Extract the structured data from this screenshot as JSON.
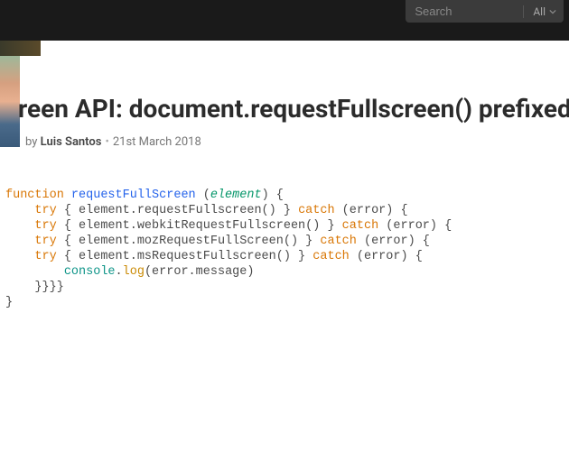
{
  "search": {
    "placeholder": "Search",
    "scope": "All"
  },
  "post": {
    "title": "reen API: document.requestFullscreen() prefixed",
    "by_label": "by ",
    "author": "Luis Santos",
    "date": "21st March 2018"
  },
  "code": {
    "tokens": [
      [
        [
          "kw",
          "function"
        ],
        [
          "pn",
          " "
        ],
        [
          "fn",
          "requestFullScreen"
        ],
        [
          "pn",
          " ("
        ],
        [
          "pr",
          "element"
        ],
        [
          "pn",
          ") {"
        ]
      ],
      [
        [
          "pn",
          "    "
        ],
        [
          "kw",
          "try"
        ],
        [
          "pn",
          " { element.requestFullscreen() } "
        ],
        [
          "kw",
          "catch"
        ],
        [
          "pn",
          " (error) {"
        ]
      ],
      [
        [
          "pn",
          "    "
        ],
        [
          "kw",
          "try"
        ],
        [
          "pn",
          " { element.webkitRequestFullscreen() } "
        ],
        [
          "kw",
          "catch"
        ],
        [
          "pn",
          " (error) {"
        ]
      ],
      [
        [
          "pn",
          "    "
        ],
        [
          "kw",
          "try"
        ],
        [
          "pn",
          " { element.mozRequestFullScreen() } "
        ],
        [
          "kw",
          "catch"
        ],
        [
          "pn",
          " (error) {"
        ]
      ],
      [
        [
          "pn",
          "    "
        ],
        [
          "kw",
          "try"
        ],
        [
          "pn",
          " { element.msRequestFullscreen() } "
        ],
        [
          "kw",
          "catch"
        ],
        [
          "pn",
          " (error) {"
        ]
      ],
      [
        [
          "pn",
          "        "
        ],
        [
          "obj",
          "console"
        ],
        [
          "pn",
          "."
        ],
        [
          "meth",
          "log"
        ],
        [
          "pn",
          "(error.message)"
        ]
      ],
      [
        [
          "pn",
          "    }}}}"
        ]
      ],
      [
        [
          "pn",
          "}"
        ]
      ]
    ]
  }
}
